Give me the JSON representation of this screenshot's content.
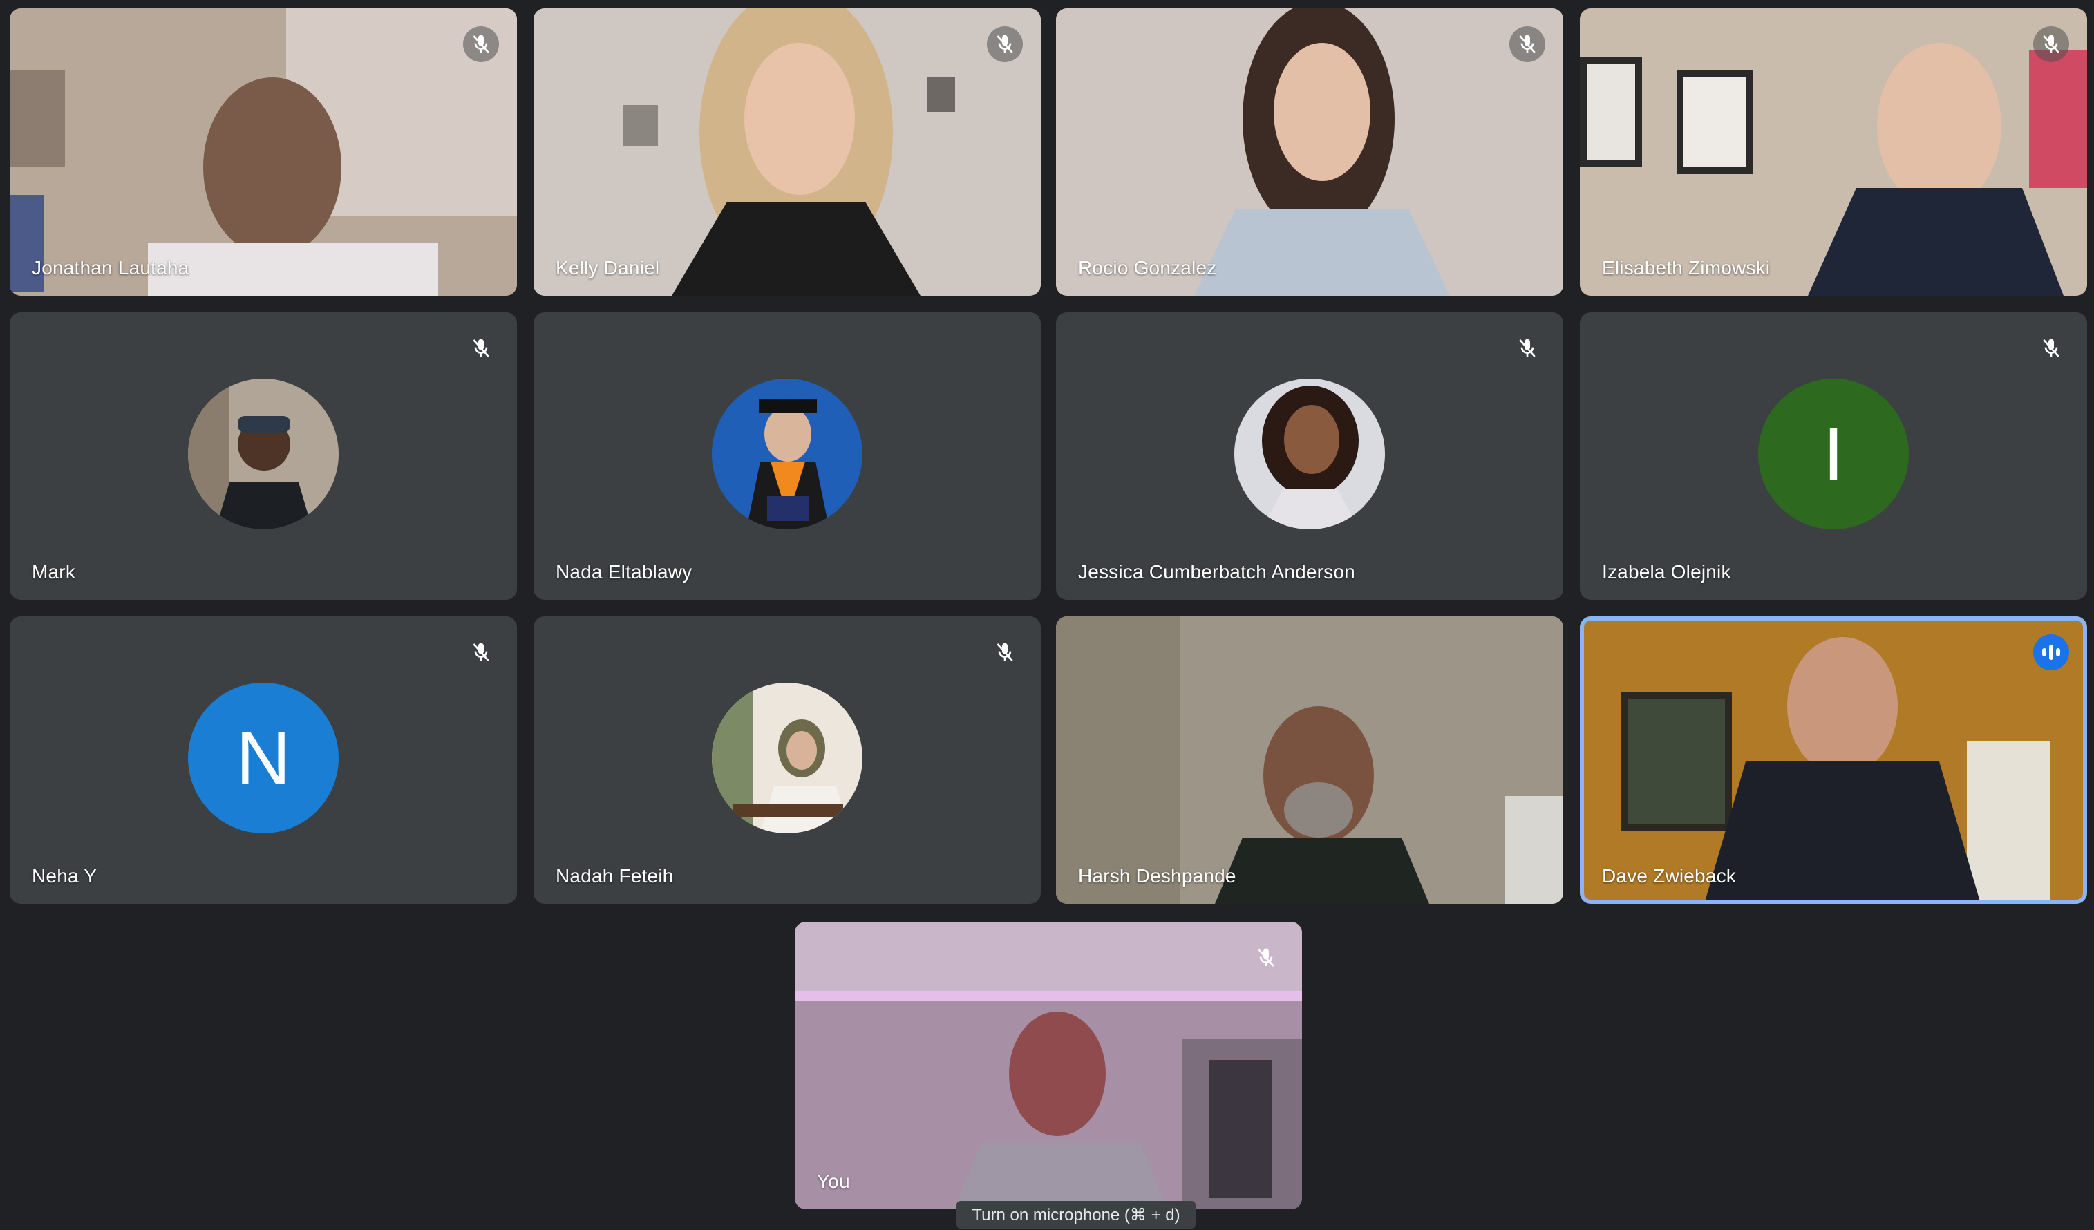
{
  "colors": {
    "background": "#202124",
    "tile_background": "#3c4043",
    "active_speaker_border": "#8ab4f8",
    "speaking_badge": "#1a73e8",
    "neha_avatar": "#1a7fd4",
    "izabela_avatar": "#2d6a1f"
  },
  "participants": [
    {
      "name": "Jonathan Lautaha",
      "type": "video",
      "muted": true
    },
    {
      "name": "Kelly Daniel",
      "type": "video",
      "muted": true
    },
    {
      "name": "Rocio Gonzalez",
      "type": "video",
      "muted": true
    },
    {
      "name": "Elisabeth Zimowski",
      "type": "video",
      "muted": true
    },
    {
      "name": "Mark",
      "type": "photo-avatar",
      "muted": true
    },
    {
      "name": "Nada Eltablawy",
      "type": "photo-avatar",
      "muted": false
    },
    {
      "name": "Jessica Cumberbatch Anderson",
      "type": "photo-avatar",
      "muted": true
    },
    {
      "name": "Izabela Olejnik",
      "type": "letter-avatar",
      "initial": "I",
      "muted": true
    },
    {
      "name": "Neha Y",
      "type": "letter-avatar",
      "initial": "N",
      "muted": true
    },
    {
      "name": "Nadah Feteih",
      "type": "photo-avatar",
      "muted": true
    },
    {
      "name": "Harsh Deshpande",
      "type": "video",
      "muted": false
    },
    {
      "name": "Dave Zwieback",
      "type": "video",
      "muted": false,
      "speaking": true
    },
    {
      "name": "You",
      "type": "video",
      "muted": true
    }
  ],
  "icons": {
    "muted": "mic-off-icon",
    "speaking": "audio-level-icon"
  },
  "tooltip": {
    "text": "Turn on microphone (⌘ + d)"
  }
}
